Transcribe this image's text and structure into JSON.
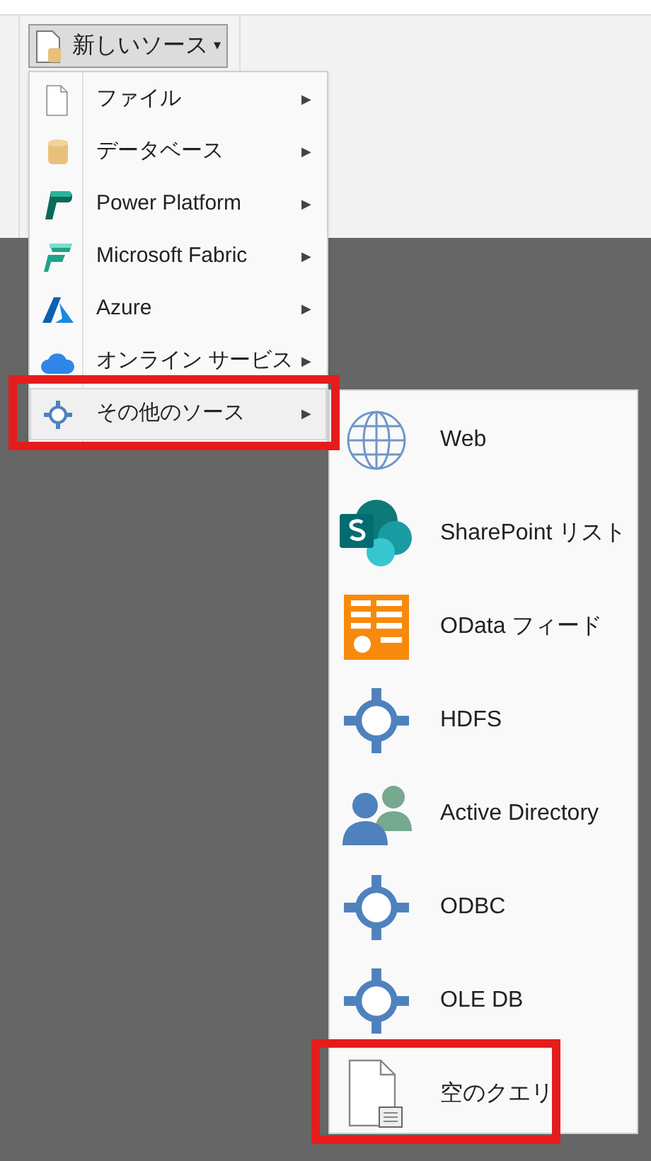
{
  "ribbon": {
    "new_source_button": {
      "label": "新しいソース",
      "caret": "▾",
      "expanded": true
    }
  },
  "menu": {
    "items": [
      {
        "label": "ファイル",
        "arrow": "▶",
        "selected": false,
        "highlighted": false
      },
      {
        "label": "データベース",
        "arrow": "▶",
        "selected": false,
        "highlighted": false
      },
      {
        "label": "Power Platform",
        "arrow": "▶",
        "selected": false,
        "highlighted": false
      },
      {
        "label": "Microsoft Fabric",
        "arrow": "▶",
        "selected": false,
        "highlighted": false
      },
      {
        "label": "Azure",
        "arrow": "▶",
        "selected": false,
        "highlighted": false
      },
      {
        "label": "オンライン サービス",
        "arrow": "▶",
        "selected": false,
        "highlighted": false
      },
      {
        "label": "その他のソース",
        "arrow": "▶",
        "selected": true,
        "highlighted": true
      }
    ]
  },
  "submenu": {
    "items": [
      {
        "label": "Web",
        "highlighted": false
      },
      {
        "label": "SharePoint リスト",
        "highlighted": false
      },
      {
        "label": "OData フィード",
        "highlighted": false
      },
      {
        "label": "HDFS",
        "highlighted": false
      },
      {
        "label": "Active Directory",
        "highlighted": false
      },
      {
        "label": "ODBC",
        "highlighted": false
      },
      {
        "label": "OLE DB",
        "highlighted": false
      },
      {
        "label": "空のクエリ",
        "highlighted": true
      }
    ]
  }
}
